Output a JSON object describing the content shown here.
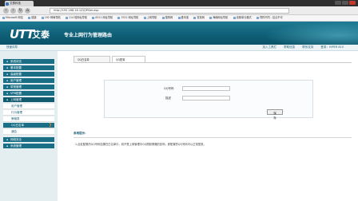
{
  "browser": {
    "tab_title": "艾泰科技",
    "url": "http://192.168.16.1/QQFilter.asp",
    "favorites": [
      "Microsoft 网站",
      "链接",
      "192 邮局导航",
      "114 啦网址导航",
      "8311 网址导航",
      "3312 网址导航",
      "上网导航",
      "搜狗网",
      "爱淘宝",
      "查找网",
      "海南网址导航",
      "设置单元格式",
      "同样不同 - 站点不可"
    ]
  },
  "header": {
    "logo_text": "UTT",
    "logo_cn": "艾泰",
    "slogan": "专业上网行为管理路由"
  },
  "subbar": {
    "left": "快速向导",
    "links": [
      "加入工具栏",
      "帮助信息",
      "联系支持",
      "登录：HiPER 810"
    ]
  },
  "sidebar": {
    "menus": [
      {
        "label": "系统状态"
      },
      {
        "label": "基本配置"
      },
      {
        "label": "高级配置"
      },
      {
        "label": "用户管理"
      },
      {
        "label": "带宽管理"
      },
      {
        "label": "VPN配置"
      },
      {
        "label": "上网管理"
      }
    ],
    "subitems": [
      {
        "label": "用户管理"
      },
      {
        "label": "行为管理"
      },
      {
        "label": "策略表"
      },
      {
        "label": "QQ白名单",
        "active": true
      },
      {
        "label": "通告"
      }
    ],
    "bottom_menus": [
      {
        "label": "网络安全"
      },
      {
        "label": "系统管理"
      }
    ]
  },
  "content": {
    "tabs": [
      "QQ白名单",
      "QQ配置"
    ],
    "form": {
      "qq_label": "QQ号码",
      "qq_value": "",
      "desc_label": "描述",
      "desc_value": "",
      "save_label": "保 存"
    },
    "tips_title": "参用提示：",
    "tips_text": "1.此处配置的QQ号码如果在白名单中，则不受上网管理中QQ限制策略的影响，即配置的QQ号码可以正常登录。"
  }
}
